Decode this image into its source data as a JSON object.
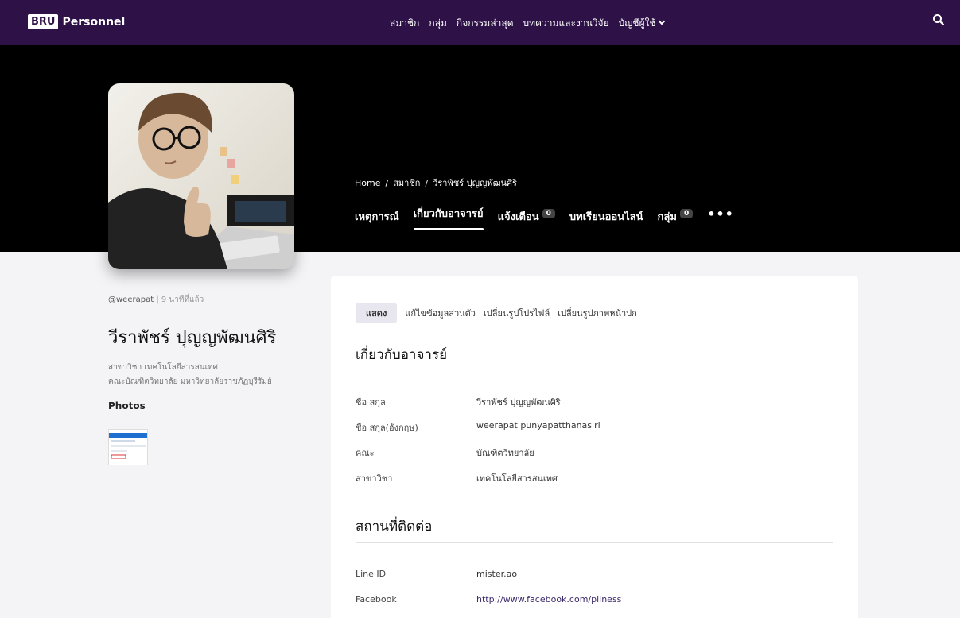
{
  "topbar": {
    "brand_box": "BRU",
    "brand_text": "Personnel",
    "nav": [
      "สมาชิก",
      "กลุ่ม",
      "กิจกรรมล่าสุด",
      "บทความและงานวิจัย",
      "บัญชีผู้ใช้"
    ],
    "search_icon": "search-icon"
  },
  "breadcrumb": [
    "Home",
    "สมาชิก",
    "วีราพัชร์ ปุญญพัฒนศิริ"
  ],
  "profile_tabs": [
    {
      "label": "เหตุการณ์"
    },
    {
      "label": "เกี่ยวกับอาจารย์",
      "active": true
    },
    {
      "label": "แจ้งเตือน",
      "badge": "0"
    },
    {
      "label": "บทเรียนออนไลน์"
    },
    {
      "label": "กลุ่ม",
      "badge": "0"
    }
  ],
  "more_label": "•••",
  "profile": {
    "username": "@weerapat",
    "meta_sep": "|",
    "last_active": "9 นาทีที่แล้ว",
    "name": "วีราพัชร์ ปุญญพัฒนศิริ",
    "major": "สาขาวิชา เทคโนโลยีสารสนเทศ",
    "faculty": "คณะบัณฑิตวิทยาลัย มหาวิทยาลัยราชภัฏบุรีรัมย์",
    "photos_heading": "Photos"
  },
  "subtabs": [
    "แสดง",
    "แก้ไขข้อมูลส่วนตัว",
    "เปลี่ยนรูปโปรไฟล์",
    "เปลี่ยนรูปภาพหน้าปก"
  ],
  "about": {
    "heading": "เกี่ยวกับอาจารย์",
    "rows": [
      {
        "label": "ชื่อ สกุล",
        "value": "วีราพัชร์ ปุญญพัฒนศิริ"
      },
      {
        "label": "ชื่อ สกุล(อังกฤษ)",
        "value": "weerapat punyapatthanasiri"
      },
      {
        "label": "คณะ",
        "value": "บัณฑิตวิทยาลัย"
      },
      {
        "label": "สาขาวิชา",
        "value": "เทคโนโลยีสารสนเทศ"
      }
    ]
  },
  "contact": {
    "heading": "สถานที่ติดต่อ",
    "rows": [
      {
        "label": "Line ID",
        "value": "mister.ao"
      },
      {
        "label": "Facebook",
        "value": "http://www.facebook.com/pliness"
      }
    ]
  },
  "colors": {
    "topbar": "#2d1147",
    "hero": "#000000",
    "link": "#3b2a6b"
  }
}
